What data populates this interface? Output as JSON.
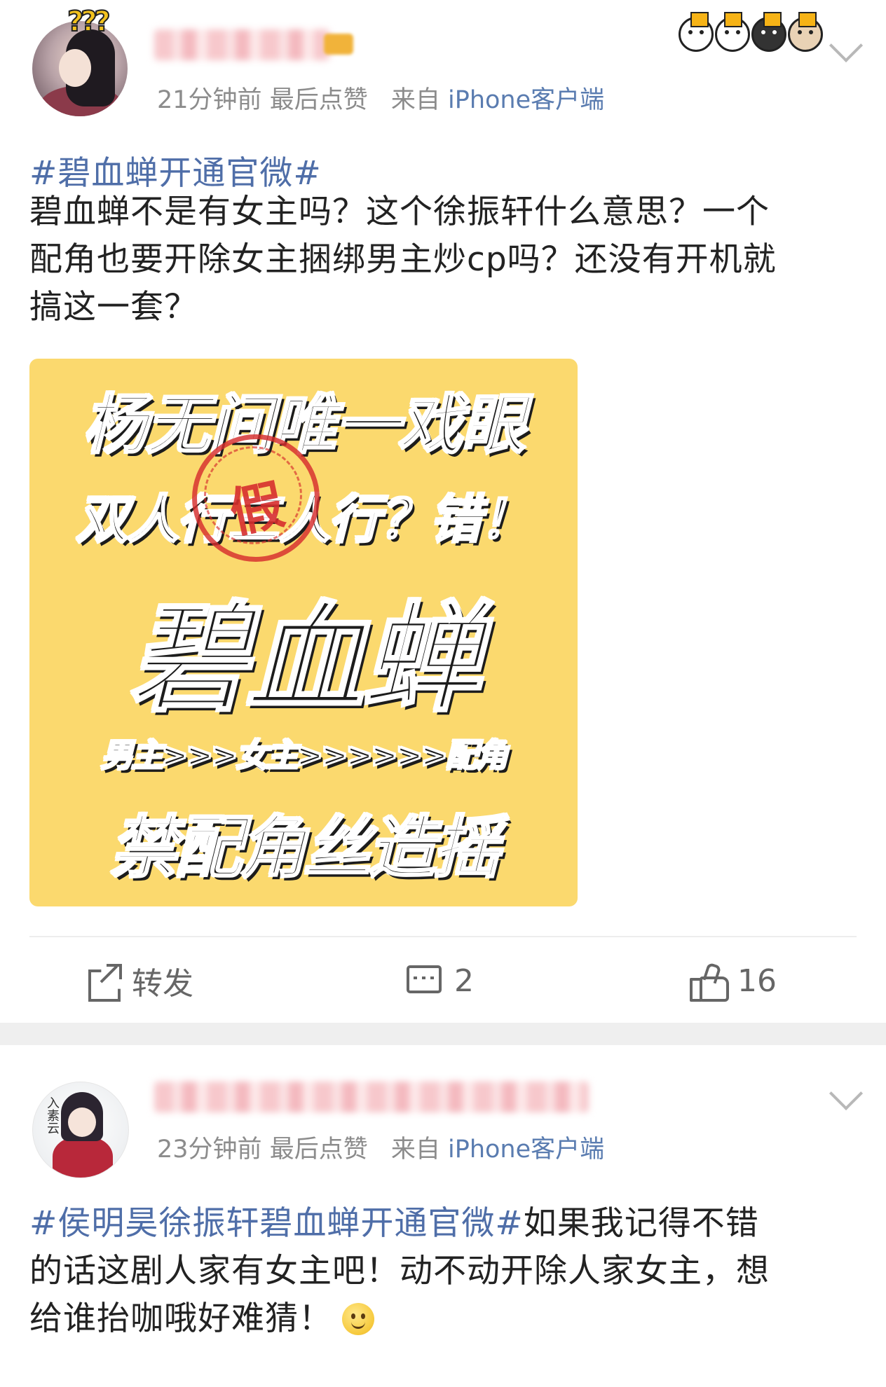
{
  "post1": {
    "meta_time": "21分钟前",
    "meta_last_like": "最后点赞",
    "meta_from": "来自",
    "meta_client": "iPhone客户端",
    "hashtag": "#碧血蝉开通官微#",
    "body_lines": [
      "碧血蝉不是有女主吗？这个徐振轩什么意思？一个",
      "配角也要开除女主捆绑男主炒cp吗？还没有开机就",
      "搞这一套？"
    ],
    "poster": {
      "line1": "杨无间唯一戏眼",
      "line2": "双人行三人行？错！",
      "line3": "碧血蝉",
      "line4": "男主>>>女主>>>>>>配角",
      "line5": "禁配角丝造摇",
      "stamp": "假"
    },
    "actions": {
      "repost_label": "转发",
      "comments": "2",
      "likes": "16"
    }
  },
  "post2": {
    "meta_time": "23分钟前",
    "meta_last_like": "最后点赞",
    "meta_from": "来自",
    "meta_client": "iPhone客户端",
    "hashtag": "#侯明昊徐振轩碧血蝉开通官微#",
    "line1_rest": "如果我记得不错",
    "line2": "的话这剧人家有女主吧！动不动开除人家女主，想",
    "line3": "给谁抬咖哦好难猜！"
  }
}
